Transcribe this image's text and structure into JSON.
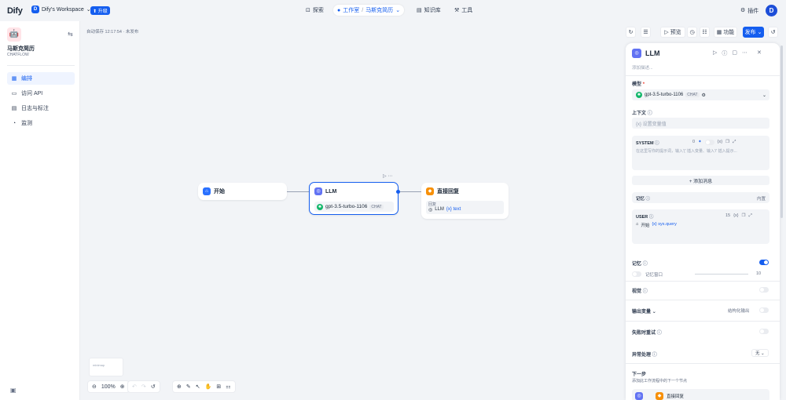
{
  "top": {
    "logo": "Dify",
    "workspace_initial": "D",
    "workspace": "Dify's Workspace",
    "upgrade": "升级",
    "nav": {
      "explore": "探索",
      "studio": "工作室",
      "app_crumb": "马斯克简历",
      "knowledge": "知识库",
      "tools": "工具"
    },
    "plugins": "插件",
    "avatar": "D"
  },
  "sidebar": {
    "app_name": "马斯克简历",
    "app_type": "CHATFLOW",
    "items": [
      {
        "label": "编排",
        "icon": "layout-icon"
      },
      {
        "label": "访问 API",
        "icon": "terminal-icon"
      },
      {
        "label": "日志与标注",
        "icon": "file-list-icon"
      },
      {
        "label": "监测",
        "icon": "monitor-icon"
      }
    ]
  },
  "canvas": {
    "autosave": "自动保存 12:17:54 · 未发布",
    "toolbar": {
      "preview": "预览",
      "features": "功能",
      "publish": "发布"
    },
    "nodes": {
      "start": {
        "title": "开始"
      },
      "llm": {
        "title": "LLM",
        "model": "gpt-3.5-turbo-1106",
        "model_badge": "CHAT"
      },
      "answer": {
        "title": "直接回复",
        "reply_label": "回复",
        "var_node": "LLM",
        "var_name": "{x} text"
      }
    },
    "minimap_label": "minimap",
    "zoom": "100%"
  },
  "panel": {
    "title": "LLM",
    "desc_placeholder": "添加描述...",
    "model_label": "模型",
    "required_star": "*",
    "model": "gpt-3.5-turbo-1106",
    "model_badge": "CHAT",
    "context_label": "上下文",
    "context_placeholder": "{x} 设置变量值",
    "system_label": "SYSTEM",
    "system_count": "0",
    "system_var": "{x}",
    "system_placeholder": "在这里写你的提示词，输入'{' 插入变量、输入'/' 插入提示...",
    "add_message": "+ 添加消息",
    "memory_top_label": "记忆",
    "memory_builtin": "内置",
    "user_label": "USER",
    "user_count": "15",
    "user_var_node": "开始",
    "user_var": "{x} sys.query",
    "memory_label": "记忆",
    "memory_window": "记忆窗口",
    "memory_window_value": "10",
    "vision_label": "视觉",
    "output_vars": "输出变量",
    "structured_output": "结构化输出",
    "retry_label": "失败时重试",
    "error_label": "异常处理",
    "error_value": "无",
    "next_label": "下一步",
    "next_desc": "添加此工作流程中的下一个节点",
    "next_node": "直接回复"
  },
  "colors": {
    "accent": "#155eef",
    "llm": "#6172f3",
    "start": "#2970ff",
    "answer": "#f79009"
  }
}
